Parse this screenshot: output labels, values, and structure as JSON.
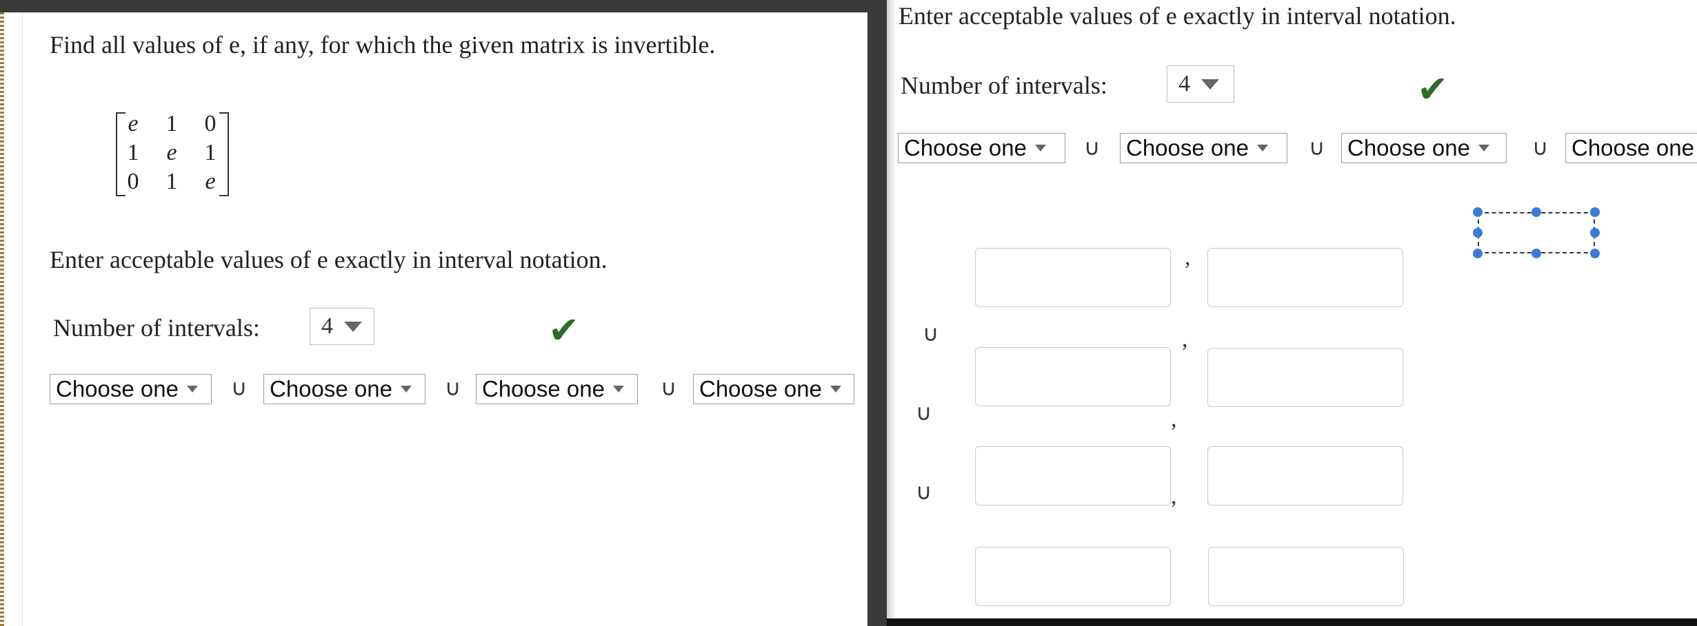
{
  "left": {
    "question": "Find all values of e, if any, for which the given matrix is invertible.",
    "matrix": [
      [
        "e",
        "1",
        "0"
      ],
      [
        "1",
        "e",
        "1"
      ],
      [
        "0",
        "1",
        "e"
      ]
    ],
    "instruction": "Enter acceptable values of e exactly in interval notation.",
    "intervals_label": "Number of intervals:",
    "intervals_value": "4",
    "check_icon": "✔",
    "choose": [
      "Choose one",
      "Choose one",
      "Choose one",
      "Choose one"
    ],
    "union": "∪"
  },
  "right": {
    "instruction": "Enter acceptable values of e exactly in interval notation.",
    "intervals_label": "Number of intervals:",
    "intervals_value": "4",
    "check_icon": "✔",
    "choose": [
      "Choose one",
      "Choose one",
      "Choose one",
      "Choose one"
    ],
    "union": "∪",
    "comma": ","
  },
  "colors": {
    "check": "#2f6b2a",
    "handle": "#3a7bd5",
    "chrome": "#3a3a3a"
  }
}
